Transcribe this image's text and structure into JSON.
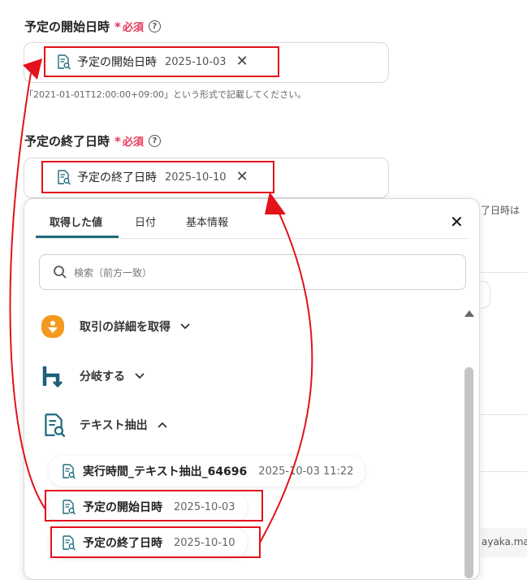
{
  "start_field": {
    "label": "予定の開始日時",
    "required": "必須",
    "required_mark": "*",
    "help": "?",
    "chip_title": "予定の開始日時",
    "chip_value": "2025-10-03",
    "remove": "✕",
    "hint": "「2021-01-01T12:00:00+09:00」という形式で記載してください。"
  },
  "end_field": {
    "label": "予定の終了日時",
    "required": "必須",
    "required_mark": "*",
    "help": "?",
    "chip_title": "予定の終了日時",
    "chip_value": "2025-10-10",
    "remove": "✕"
  },
  "background": {
    "right_text_1": "了日時は",
    "right_text_2": "ayaka.ma"
  },
  "panel": {
    "tabs": [
      "取得した値",
      "日付",
      "基本情報"
    ],
    "active_tab": 0,
    "close": "✕",
    "search_placeholder": "検索（前方一致）",
    "operations": [
      {
        "label": "取引の詳細を取得",
        "icon": "orange-app-icon",
        "expanded": false
      },
      {
        "label": "分岐する",
        "icon": "branch-icon",
        "expanded": false
      },
      {
        "label": "テキスト抽出",
        "icon": "text-extract-icon",
        "expanded": true
      }
    ],
    "items": [
      {
        "title": "実行時間_テキスト抽出_64696",
        "value": "2025-10-03 11:22"
      },
      {
        "title": "予定の開始日時",
        "value": "2025-10-03"
      },
      {
        "title": "予定の終了日時",
        "value": "2025-10-10"
      }
    ]
  },
  "colors": {
    "annotation_red": "#e3121b",
    "accent": "#1f6b7c",
    "required": "#e8375a"
  }
}
